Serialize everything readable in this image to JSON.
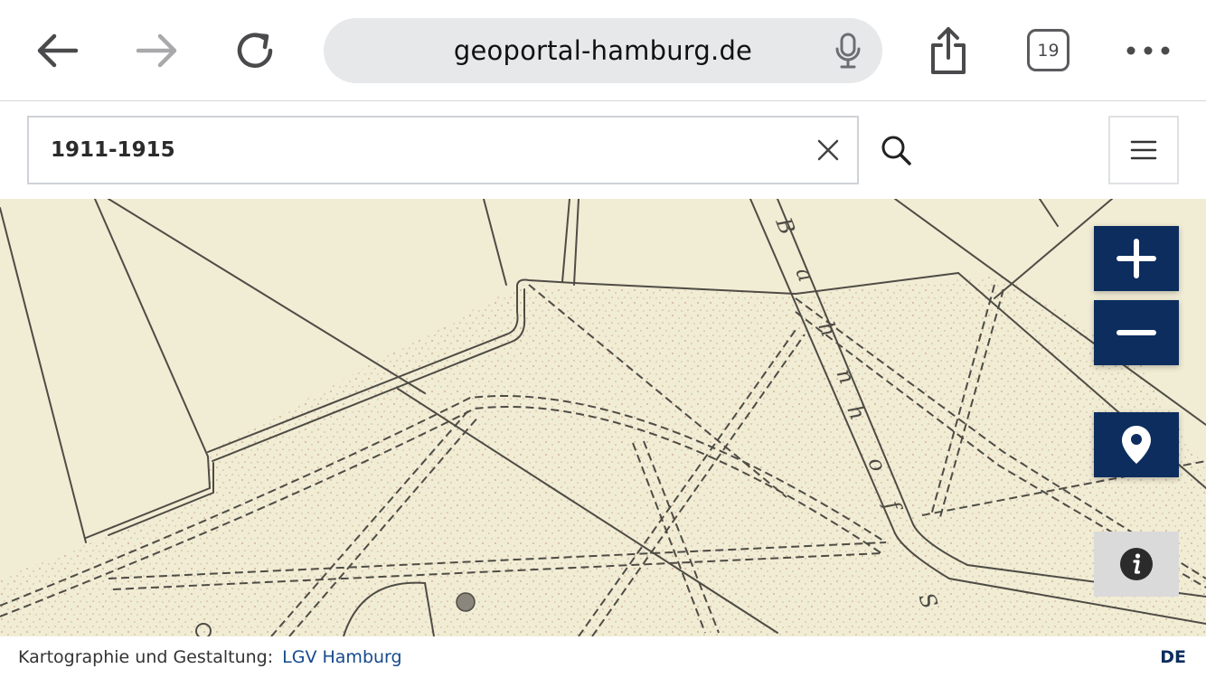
{
  "browser": {
    "url": "geoportal-hamburg.de",
    "tab_count": "19",
    "icons": [
      "back-arrow-icon",
      "forward-arrow-icon",
      "reload-icon",
      "microphone-icon",
      "share-icon",
      "tabs-icon",
      "more-icon"
    ]
  },
  "search": {
    "value": "1911-1915",
    "icons": [
      "clear-icon",
      "search-icon",
      "hamburger-menu-icon"
    ]
  },
  "map": {
    "label_letters": [
      "B",
      "a",
      "h",
      "n",
      "h",
      "o",
      "f",
      "S"
    ],
    "controls": [
      "zoom-in-icon",
      "zoom-out-icon",
      "location-pin-icon",
      "info-icon"
    ],
    "colors": {
      "control_bg": "#0c2d5e",
      "paper": "#f1ecd4",
      "ink": "#4e4c45",
      "stipple": "#c49a7e"
    }
  },
  "footer": {
    "attribution_label": "Kartographie und Gestaltung:",
    "attribution_link": "LGV Hamburg",
    "language": "DE"
  }
}
